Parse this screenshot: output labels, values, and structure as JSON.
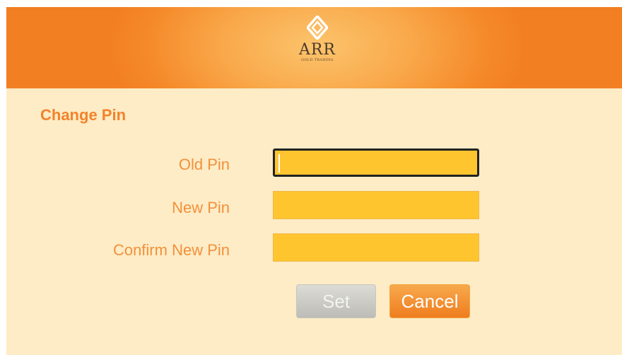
{
  "header": {
    "logo_name": "ARR",
    "logo_subtitle": "GOLD TRADING"
  },
  "form": {
    "title": "Change Pin",
    "fields": [
      {
        "label": "Old Pin",
        "value": ""
      },
      {
        "label": "New Pin",
        "value": ""
      },
      {
        "label": "Confirm New Pin",
        "value": ""
      }
    ]
  },
  "buttons": {
    "set_label": "Set",
    "cancel_label": "Cancel"
  },
  "colors": {
    "header_orange": "#f58a2a",
    "background": "#fdecc6",
    "field_fill": "#fec52f",
    "label_text": "#f2913c",
    "title_text": "#f2832b"
  }
}
